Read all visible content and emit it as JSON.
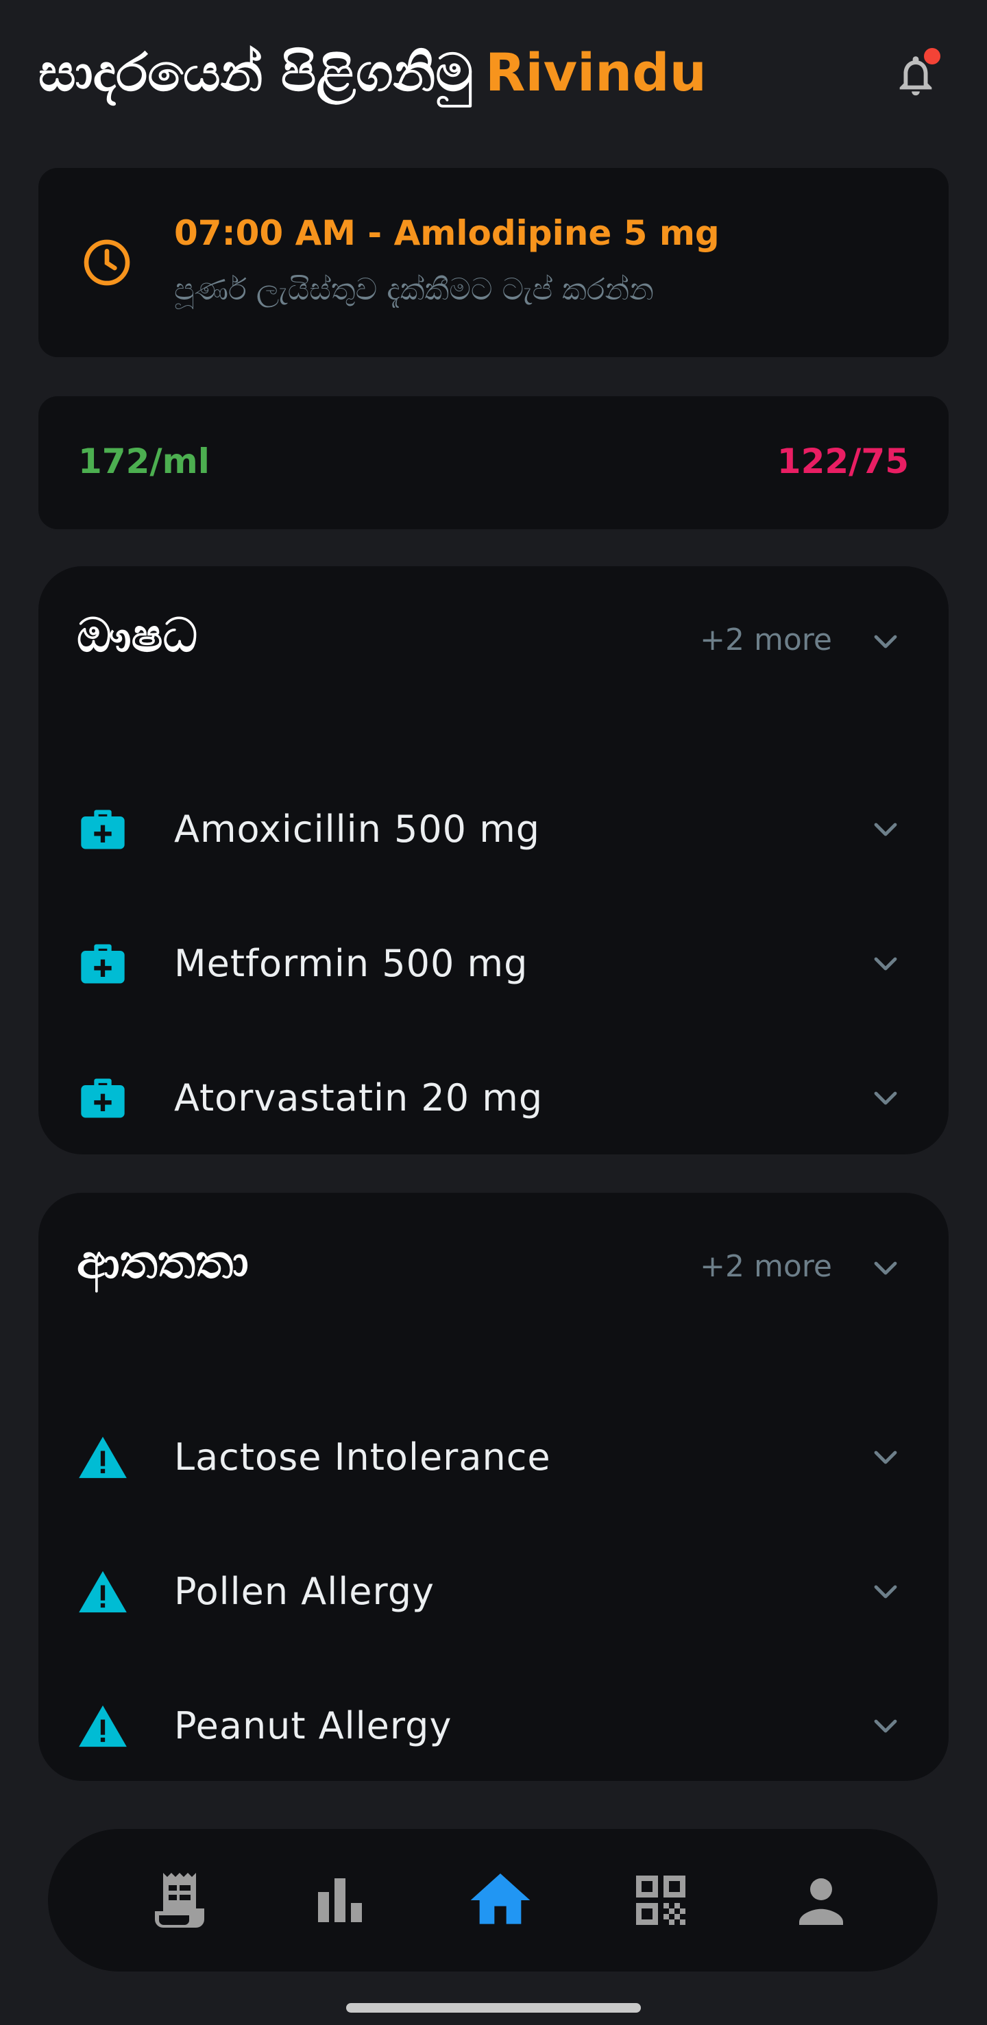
{
  "header": {
    "greeting": "සාදරයෙන් පිළිගනිමු",
    "username": "Rivindu",
    "notification_icon": "bell-icon",
    "has_unread": true
  },
  "reminder": {
    "icon": "clock-icon",
    "title": "07:00 AM - Amlodipine 5 mg",
    "subtitle": "පූර්ණ ලැයිස්තුව දැක්කීමට ටැප් කරන්න"
  },
  "vitals": {
    "left_value": "172/ml",
    "right_value": "122/75"
  },
  "medications": {
    "title": "ඖෂධ",
    "more": "+2 more",
    "items": [
      {
        "label": "Amoxicillin 500 mg",
        "icon": "medical-bag-icon"
      },
      {
        "label": "Metformin 500 mg",
        "icon": "medical-bag-icon"
      },
      {
        "label": "Atorvastatin 20 mg",
        "icon": "medical-bag-icon"
      }
    ]
  },
  "allergies": {
    "title": "ආතතතා",
    "more": "+2 more",
    "items": [
      {
        "label": "Lactose Intolerance",
        "icon": "warning-icon"
      },
      {
        "label": "Pollen Allergy",
        "icon": "warning-icon"
      },
      {
        "label": "Peanut Allergy",
        "icon": "warning-icon"
      }
    ]
  },
  "bottom_nav": {
    "items": [
      {
        "name": "receipt-icon",
        "active": false
      },
      {
        "name": "bar-chart-icon",
        "active": false
      },
      {
        "name": "home-icon",
        "active": true
      },
      {
        "name": "qr-code-icon",
        "active": false
      },
      {
        "name": "person-icon",
        "active": false
      }
    ]
  },
  "colors": {
    "accent": "#f7941d",
    "good": "#4caf50",
    "alert": "#e91e63",
    "icon_teal": "#00bcd4",
    "nav_active": "#2196f3",
    "nav_inactive": "#9e9e9e"
  }
}
